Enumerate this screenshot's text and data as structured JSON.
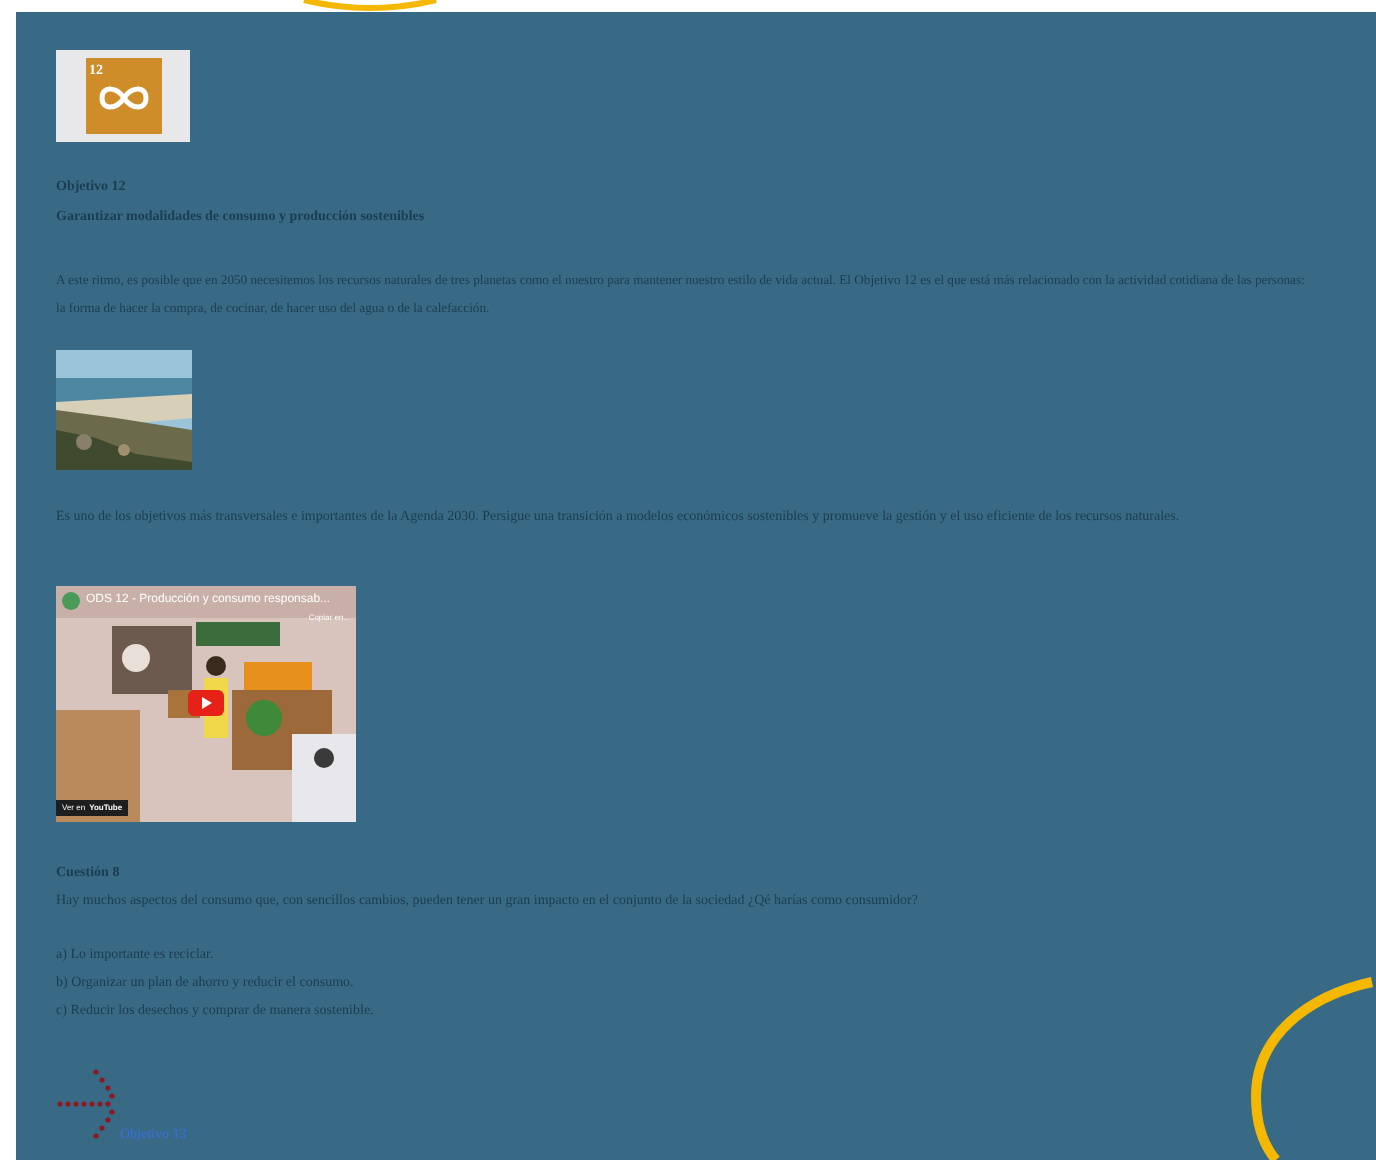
{
  "sdg_badge": {
    "number": "12"
  },
  "heading": {
    "label": "Objetivo 12",
    "title": "Garantizar modalidades de consumo y producción sostenibles"
  },
  "intro": [
    "A este ritmo, es posible que en 2050 necesitemos los recursos naturales de tres planetas como el nuestro para mantener nuestro estilo de vida actual. El Objetivo 12 es el que está más relacionado con la actividad cotidiana de las personas:",
    "la forma de hacer la compra, de cocinar, de hacer uso del agua o de la calefacción."
  ],
  "summary": "Es uno de los objetivos más transversales e importantes de la Agenda 2030. Persigue una transición a modelos económicos sostenibles y promueve la gestión y el uso eficiente de los recursos naturales.",
  "video": {
    "title": "ODS 12 - Producción y consumo responsab...",
    "copy_label": "Copiar en...",
    "watch_label": "Ver en",
    "platform": "YouTube"
  },
  "question": {
    "label": "Cuestión 8",
    "text": "Hay muchos aspectos del consumo que, con sencillos cambios, pueden tener un gran impacto en el conjunto de la sociedad ¿Qé harías como consumidor?",
    "options": [
      "a) Lo importante es reciclar.",
      "b) Organizar un plan de ahorro y reducir el consumo.",
      "c) Reducir los desechos y comprar de manera sostenible."
    ]
  },
  "next_link": "Objetivo 13"
}
